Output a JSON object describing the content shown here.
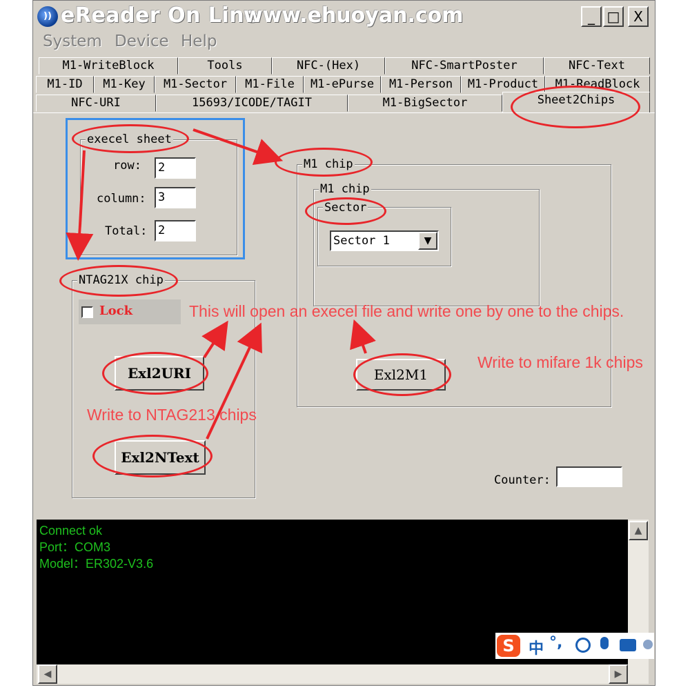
{
  "window": {
    "title": "eReader On Line",
    "url": "www.ehuoyan.com",
    "controls": {
      "minimize": "_",
      "maximize": "□",
      "close": "X"
    }
  },
  "menu": [
    "System",
    "Device",
    "Help"
  ],
  "tabs": {
    "row1": [
      "M1-WriteBlock",
      "Tools",
      "NFC-(Hex)",
      "NFC-SmartPoster",
      "NFC-Text"
    ],
    "row2": [
      "M1-ID",
      "M1-Key",
      "M1-Sector",
      "M1-File",
      "M1-ePurse",
      "M1-Person",
      "M1-Product",
      "M1-ReadBlock"
    ],
    "row3": [
      "NFC-URI",
      "15693/ICODE/TAGIT",
      "M1-BigSector",
      "Sheet2Chips"
    ],
    "active": "Sheet2Chips"
  },
  "excel_sheet": {
    "label": "execel sheet",
    "row_label": "row:",
    "row_value": "2",
    "column_label": "column:",
    "column_value": "3",
    "total_label": "Total:",
    "total_value": "2"
  },
  "ntag": {
    "label": "NTAG21X chip",
    "lock_label": "Lock",
    "lock_checked": false,
    "url_button": "Exl2URI",
    "text_button": "Exl2NText"
  },
  "m1": {
    "outer_label": "M1 chip",
    "inner_label": "M1 chip",
    "sector_label": "Sector",
    "sector_value": "Sector 1",
    "button": "Exl2M1"
  },
  "counter": {
    "label": "Counter:",
    "value": ""
  },
  "console": {
    "lines": [
      "Connect ok",
      "Port：COM3",
      "Model：ER302-V3.6"
    ]
  },
  "annotations": {
    "open_excel": "This will open an execel file and write one by one to the chips.",
    "mifare": "Write to mifare 1k chips",
    "ntag": "Write to NTAG213 chips"
  },
  "ime": {
    "chars": [
      "中",
      "°,"
    ]
  },
  "colors": {
    "annotation": "#e8252a",
    "console_text": "#1ec01e",
    "highlight_box": "#3b8ee8"
  }
}
